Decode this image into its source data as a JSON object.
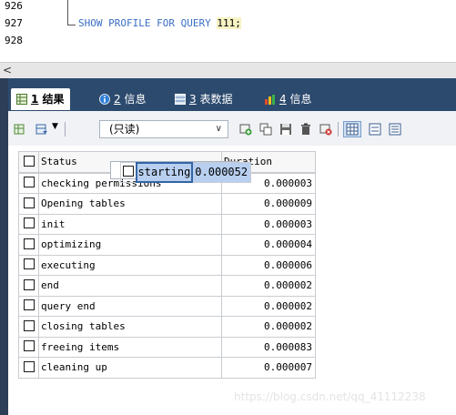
{
  "editor": {
    "line_numbers": [
      "926",
      "927",
      "928"
    ],
    "sql_keyword": "SHOW PROFILE FOR QUERY ",
    "sql_number": "111",
    "sql_semicolon": ";"
  },
  "scrollbar": {
    "left_arrow": "<"
  },
  "tabs": [
    {
      "num": "1",
      "label": "结果",
      "icon": "grid-icon",
      "active": true
    },
    {
      "num": "2",
      "label": "信息",
      "icon": "info-icon"
    },
    {
      "num": "3",
      "label": "表数据",
      "icon": "table-icon"
    },
    {
      "num": "4",
      "label": "信息",
      "icon": "chart-icon"
    }
  ],
  "toolbar": {
    "mode_select": "(只读)",
    "icons": [
      "export-icon",
      "filter-icon",
      "add-row-icon",
      "copy-row-icon",
      "save-icon",
      "delete-icon",
      "cancel-icon",
      "grid-view-icon",
      "form-view-icon",
      "text-view-icon"
    ]
  },
  "results": {
    "columns": [
      "Status",
      "Duration"
    ],
    "rows": [
      {
        "status": "starting",
        "duration": "0.000052"
      },
      {
        "status": "checking permissions",
        "duration": "0.000003"
      },
      {
        "status": "Opening tables",
        "duration": "0.000009"
      },
      {
        "status": "init",
        "duration": "0.000003"
      },
      {
        "status": "optimizing",
        "duration": "0.000004"
      },
      {
        "status": "executing",
        "duration": "0.000006"
      },
      {
        "status": "end",
        "duration": "0.000002"
      },
      {
        "status": "query end",
        "duration": "0.000002"
      },
      {
        "status": "closing tables",
        "duration": "0.000002"
      },
      {
        "status": "freeing items",
        "duration": "0.000083"
      },
      {
        "status": "cleaning up",
        "duration": "0.000007"
      }
    ]
  },
  "watermark": "https://blog.csdn.net/qq_41112238",
  "colors": {
    "tab_bar": "#2c4a6e",
    "selected_row": "#b8cff0",
    "keyword": "#3a6ec6"
  }
}
